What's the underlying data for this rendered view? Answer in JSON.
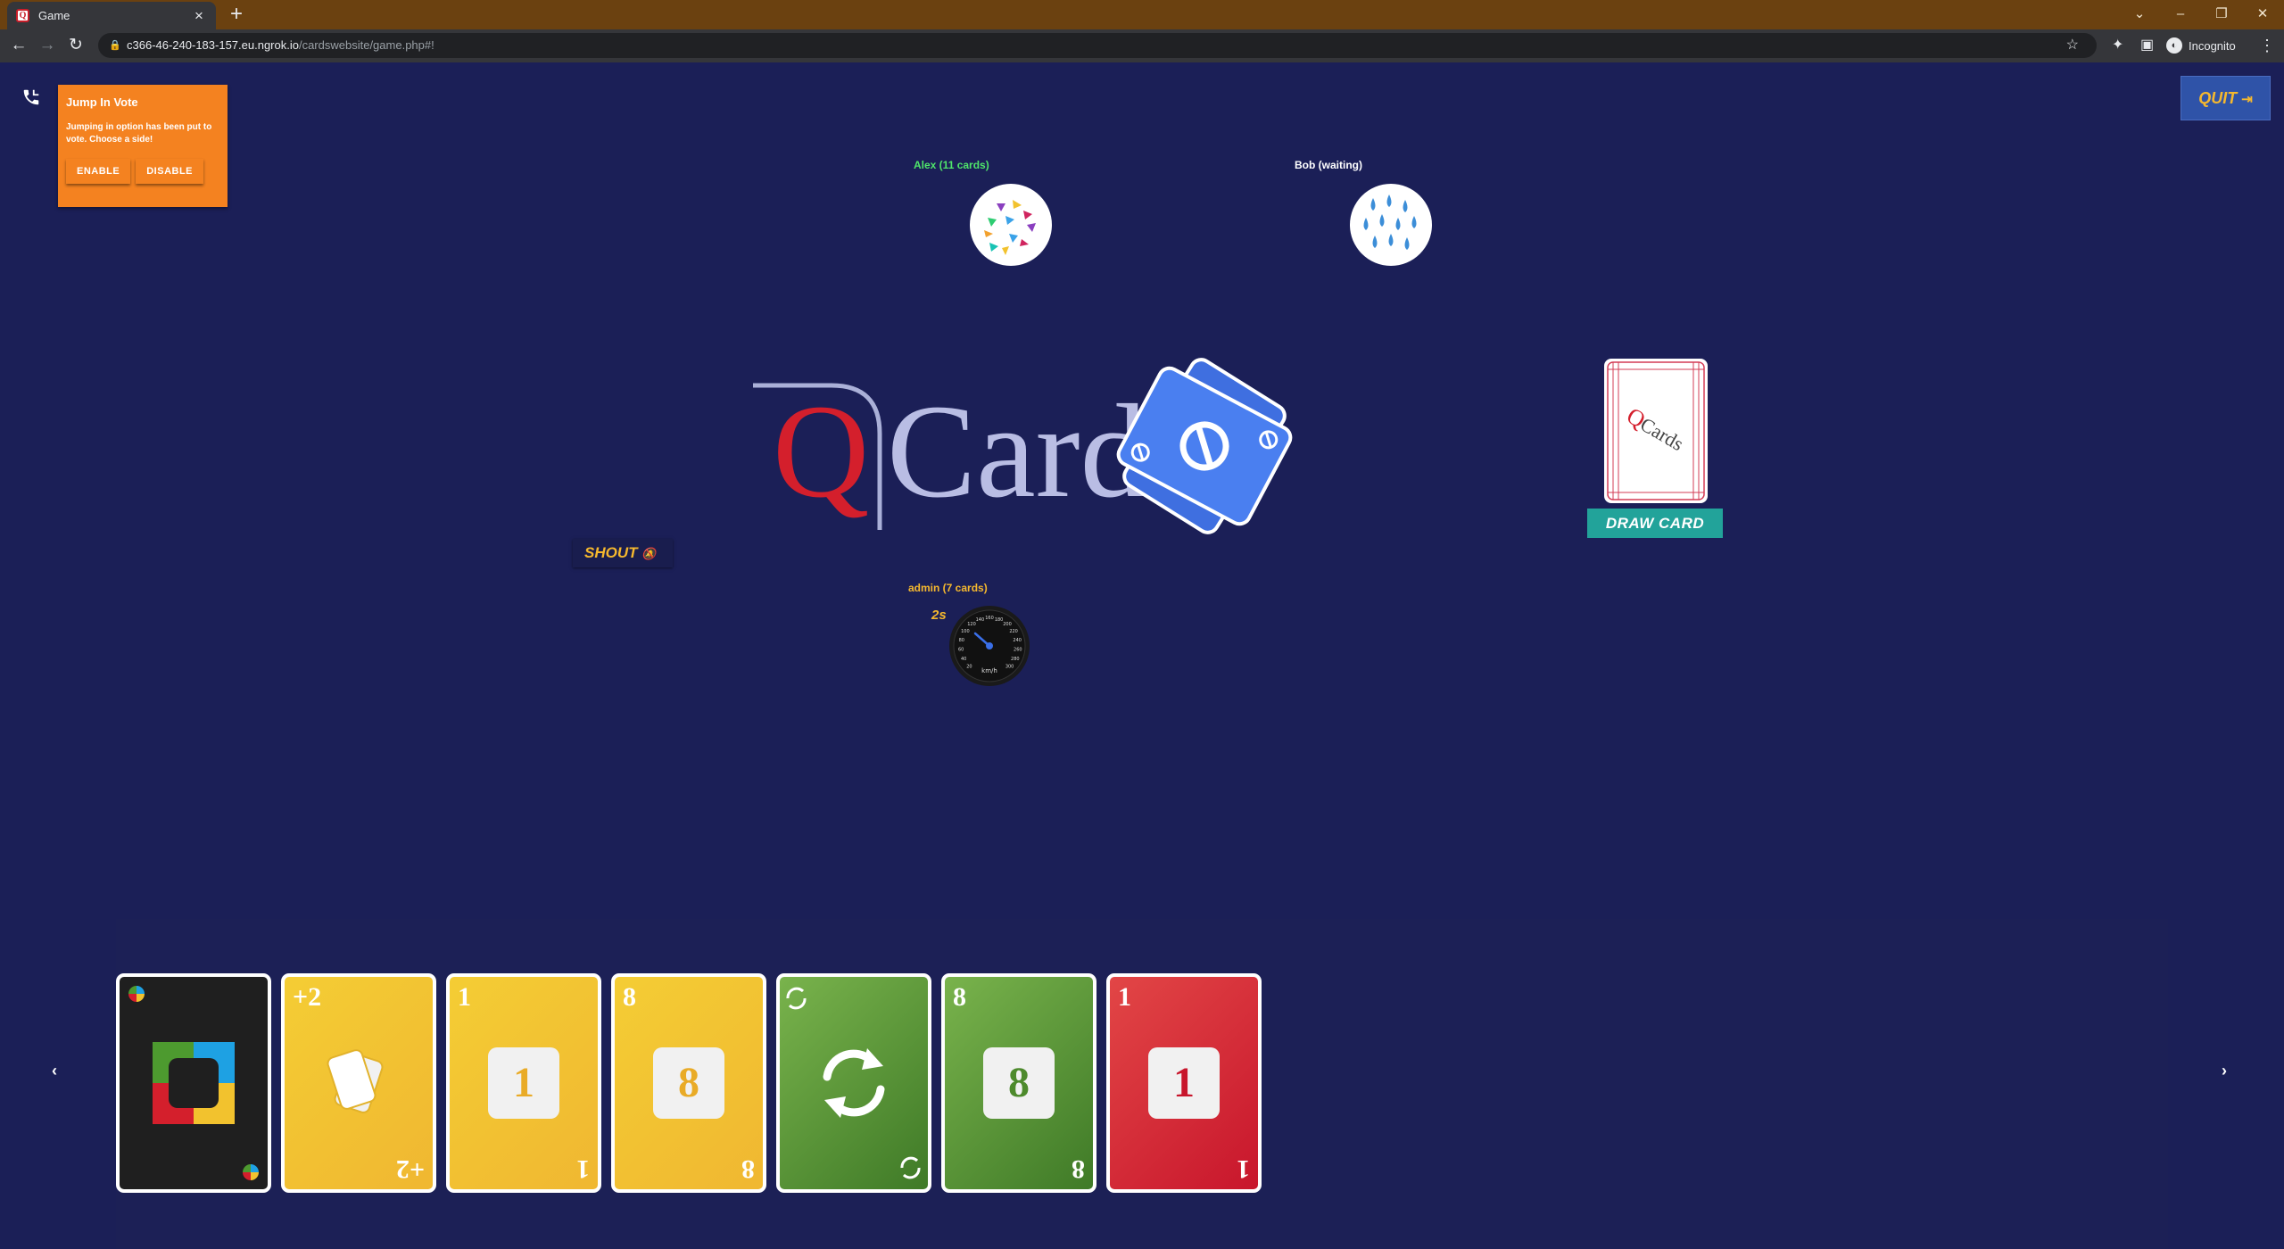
{
  "browser": {
    "tab_title": "Game",
    "tab_favicon": "Q",
    "url_host": "c366-46-240-183-157.eu.ngrok.io",
    "url_path": "/cardswebsite/game.php#!",
    "profile_label": "Incognito"
  },
  "vote": {
    "title": "Jump In Vote",
    "text": "Jumping in option has been put to vote. Choose a side!",
    "enable_label": "ENABLE",
    "disable_label": "DISABLE"
  },
  "quit_label": "QUIT",
  "players": {
    "alex": {
      "label": "Alex (11 cards)",
      "color": "#4fe56a"
    },
    "bob": {
      "label": "Bob (waiting)",
      "color": "#ffffff"
    },
    "admin": {
      "label": "admin (7 cards)",
      "color": "#f5b82e"
    }
  },
  "logo": {
    "letter": "Q",
    "word": "Cards"
  },
  "deck_logo": {
    "letter": "Q",
    "word": "Cards"
  },
  "draw_label": "DRAW CARD",
  "shout_label": "SHOUT",
  "timer": {
    "seconds_label": "2s",
    "gauge_unit": "km/h",
    "gauge_ticks": [
      "20",
      "40",
      "60",
      "80",
      "100",
      "120",
      "140",
      "160",
      "180",
      "200",
      "220",
      "240",
      "260",
      "280",
      "300"
    ]
  },
  "hand": [
    {
      "type": "wild",
      "color": "black",
      "icon": "wild-multicolor-icon"
    },
    {
      "type": "draw-two",
      "color": "yellow",
      "corner": "+2",
      "icon": "two-cards-icon"
    },
    {
      "type": "number",
      "color": "yellow",
      "corner": "1",
      "center": "1",
      "center_color": "#e9ab27"
    },
    {
      "type": "number",
      "color": "yellow",
      "corner": "8",
      "center": "8",
      "center_color": "#e9ab27"
    },
    {
      "type": "reverse",
      "color": "green",
      "icon": "reverse-arrows-icon"
    },
    {
      "type": "number",
      "color": "green",
      "corner": "8",
      "center": "8",
      "center_color": "#4d8a2c"
    },
    {
      "type": "number",
      "color": "red",
      "corner": "1",
      "center": "1",
      "center_color": "#c8162c"
    }
  ],
  "discard_top": {
    "type": "skip",
    "color": "blue"
  }
}
